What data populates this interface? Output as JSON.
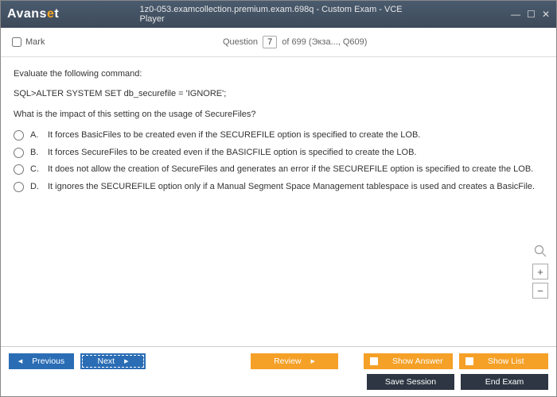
{
  "window": {
    "title": "1z0-053.examcollection.premium.exam.698q - Custom Exam - VCE Player",
    "logo_main": "Avans",
    "logo_accent": "e",
    "logo_tail": "t"
  },
  "header": {
    "mark_label": "Mark",
    "question_label": "Question",
    "current": "7",
    "total_suffix": " of 699 (Экза..., Q609)"
  },
  "question": {
    "intro": "Evaluate the following command:",
    "sql": "SQL>ALTER SYSTEM SET db_securefile = 'IGNORE';",
    "prompt": "What is the impact of this setting on the usage of SecureFiles?",
    "options": [
      {
        "letter": "A.",
        "text": "It forces BasicFiles to be created even if the SECUREFILE option is specified to create the LOB."
      },
      {
        "letter": "B.",
        "text": "It forces SecureFiles to be created even if the BASICFILE option is specified to create the LOB."
      },
      {
        "letter": "C.",
        "text": "It does not allow the creation of SecureFiles and generates an error if the SECUREFILE option is specified to create the LOB."
      },
      {
        "letter": "D.",
        "text": "It ignores the SECUREFILE option only if a Manual Segment Space Management tablespace is used and creates a BasicFile."
      }
    ]
  },
  "buttons": {
    "previous": "Previous",
    "next": "Next",
    "review": "Review",
    "show_answer": "Show Answer",
    "show_list": "Show List",
    "save_session": "Save Session",
    "end_exam": "End Exam"
  },
  "zoom": {
    "plus": "+",
    "minus": "−"
  }
}
